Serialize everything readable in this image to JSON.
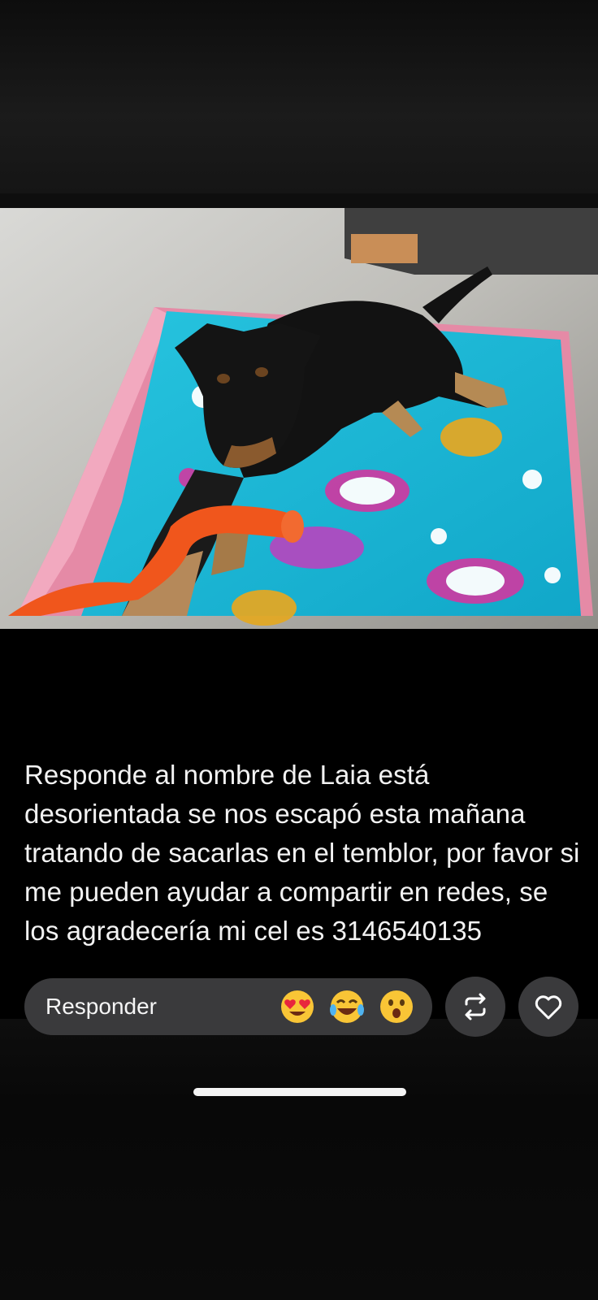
{
  "post": {
    "caption": "Responde al nombre de Laia está desorientada se nos escapó esta mañana tratando de sacarlas en el temblor, por favor si me pueden ayudar a compartir en redes, se los agradecería mi cel es 3146540135"
  },
  "reply_bar": {
    "placeholder": "Responder",
    "quick_reactions": [
      "heart-eyes-emoji",
      "laughing-tears-emoji",
      "surprised-emoji"
    ]
  },
  "actions": {
    "repost_icon": "repost-icon",
    "like_icon": "heart-icon"
  },
  "colors": {
    "blanket": "#1ab9d6",
    "bed": "#e98aa8",
    "toy": "#f0561c",
    "bar": "#3a3a3c"
  }
}
